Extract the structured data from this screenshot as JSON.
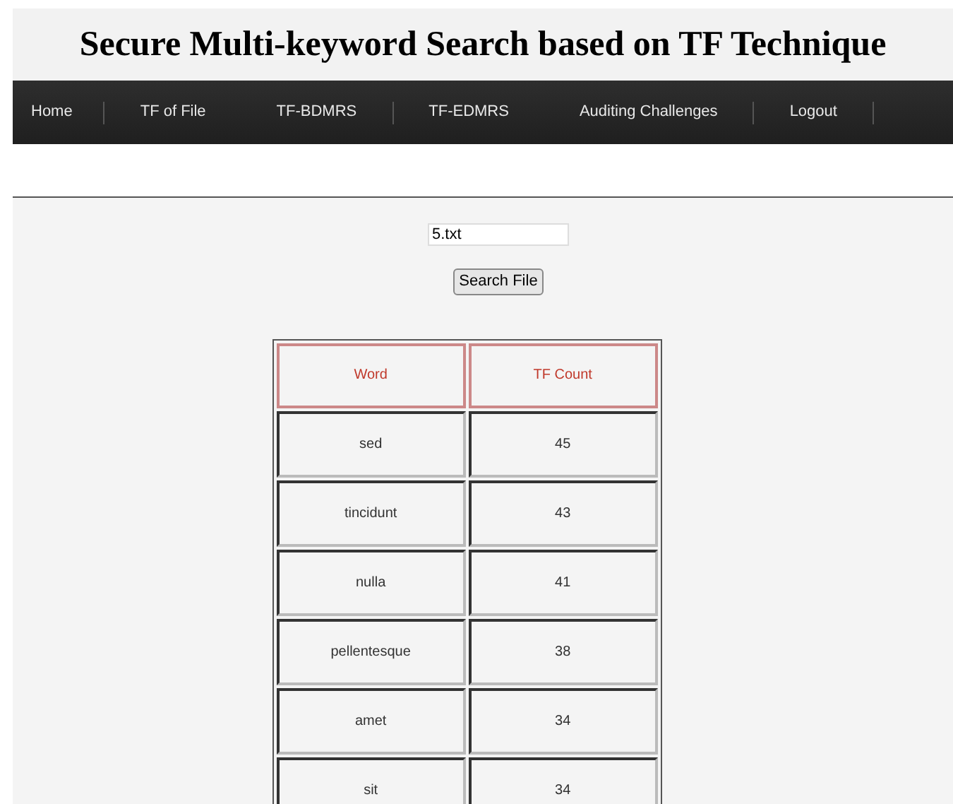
{
  "header": {
    "title": "Secure Multi-keyword Search based on TF Technique"
  },
  "nav": [
    {
      "label": "Home",
      "separator": true
    },
    {
      "label": "TF of File",
      "separator": false
    },
    {
      "label": "TF-BDMRS",
      "separator": true
    },
    {
      "label": "TF-EDMRS",
      "separator": false
    },
    {
      "label": "Auditing Challenges",
      "separator": true
    },
    {
      "label": "Logout",
      "separator": true
    }
  ],
  "search": {
    "value": "5.txt",
    "button": "Search File"
  },
  "table": {
    "columns": [
      "Word",
      "TF Count"
    ],
    "rows": [
      [
        "sed",
        "45"
      ],
      [
        "tincidunt",
        "43"
      ],
      [
        "nulla",
        "41"
      ],
      [
        "pellentesque",
        "38"
      ],
      [
        "amet",
        "34"
      ],
      [
        "sit",
        "34"
      ]
    ]
  }
}
